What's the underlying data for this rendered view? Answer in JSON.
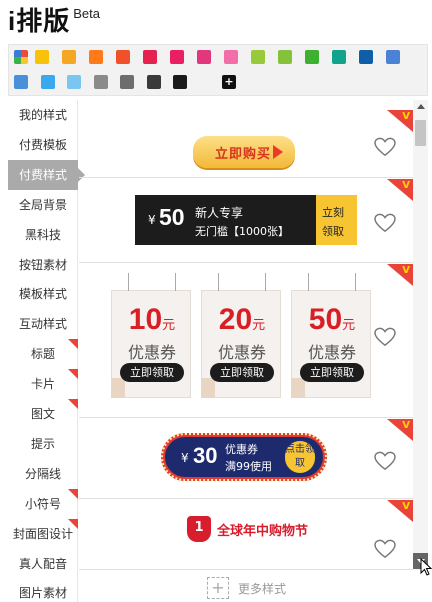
{
  "header": {
    "logo": "i排版",
    "beta": "Beta"
  },
  "colors": {
    "row1": [
      "#f7c20a",
      "#f5a623",
      "#ff7a1a",
      "#f0502a",
      "#e5224f",
      "#ea1f63",
      "#e2377d",
      "#f26ea8",
      "#98c93a",
      "#84c23b",
      "#3cb12f",
      "#12a38d",
      "#0f5fa8",
      "#4c82d6"
    ],
    "row2": [
      "#4a8fd9",
      "#3aa8ee",
      "#79c6f0",
      "#8a8a8a",
      "#6d6d6d",
      "#3a3a3a",
      "#1a1a1a"
    ],
    "add": "+"
  },
  "sidebar": {
    "items": [
      {
        "label": "我的样式",
        "flag": false,
        "active": false
      },
      {
        "label": "付费模板",
        "flag": false,
        "active": false
      },
      {
        "label": "付费样式",
        "flag": false,
        "active": true
      },
      {
        "label": "全局背景",
        "flag": false,
        "active": false
      },
      {
        "label": "黑科技",
        "flag": false,
        "active": false
      },
      {
        "label": "按钮素材",
        "flag": false,
        "active": false
      },
      {
        "label": "模板样式",
        "flag": false,
        "active": false
      },
      {
        "label": "互动样式",
        "flag": false,
        "active": false
      },
      {
        "label": "标题",
        "flag": true,
        "active": false
      },
      {
        "label": "卡片",
        "flag": true,
        "active": false
      },
      {
        "label": "图文",
        "flag": true,
        "active": false
      },
      {
        "label": "提示",
        "flag": false,
        "active": false
      },
      {
        "label": "分隔线",
        "flag": false,
        "active": false
      },
      {
        "label": "小符号",
        "flag": true,
        "active": false
      },
      {
        "label": "封面图设计",
        "flag": true,
        "active": false
      },
      {
        "label": "真人配音",
        "flag": false,
        "active": false
      },
      {
        "label": "图片素材",
        "flag": false,
        "active": false
      }
    ]
  },
  "cards": {
    "buy": {
      "label": "立即购买"
    },
    "coupon1": {
      "yen": "¥",
      "amount": "50",
      "line1": "新人专享",
      "line2": "无门槛【1000张】",
      "cta1": "立刻",
      "cta2": "领取"
    },
    "tags": [
      {
        "amount": "10",
        "unit": "元",
        "label": "优惠券",
        "button": "立即领取"
      },
      {
        "amount": "20",
        "unit": "元",
        "label": "优惠券",
        "button": "立即领取"
      },
      {
        "amount": "50",
        "unit": "元",
        "label": "优惠券",
        "button": "立即领取"
      }
    ],
    "coupon2": {
      "yen": "¥",
      "amount": "30",
      "line1": "优惠券",
      "line2": "满99使用",
      "button": "点击领取"
    },
    "festival": {
      "badge": "1",
      "title": "全球年中购物节"
    }
  },
  "more": {
    "plus": "+",
    "label": "更多样式"
  },
  "vip_mark": "V"
}
